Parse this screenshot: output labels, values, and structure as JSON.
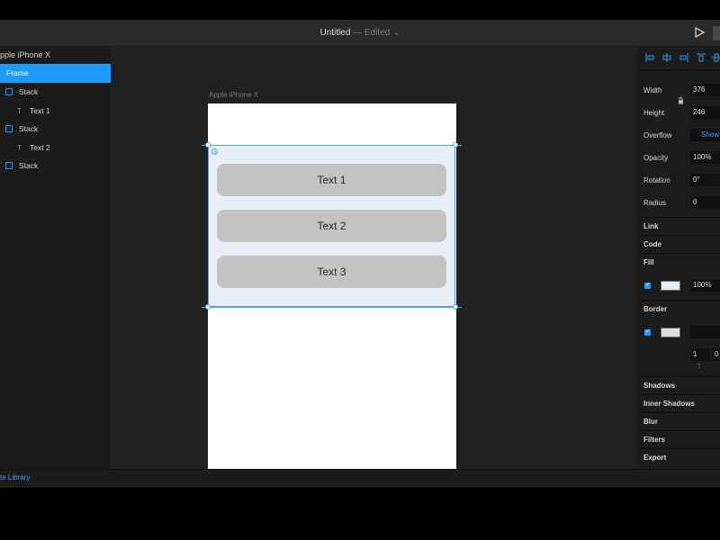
{
  "window": {
    "title": "Untitled",
    "edited_suffix": " — Edited ⌄"
  },
  "layers": {
    "title": "pple iPhone X",
    "items": [
      {
        "label": "Frame",
        "type": "frame",
        "selected": true
      },
      {
        "label": "Stack",
        "type": "stack"
      },
      {
        "label": "Text 1",
        "type": "text"
      },
      {
        "label": "Stack",
        "type": "stack"
      },
      {
        "label": "Text 2",
        "type": "text"
      },
      {
        "label": "Stack",
        "type": "stack"
      }
    ]
  },
  "canvas": {
    "frame_label": "Apple iPhone X",
    "stack_items": [
      "Text 1",
      "Text 2",
      "Text 3"
    ]
  },
  "properties": {
    "width_label": "Width",
    "width_value": "376",
    "height_label": "Height",
    "height_value": "246",
    "overflow_label": "Overflow",
    "overflow_value": "Show",
    "opacity_label": "Opacity",
    "opacity_value": "100%",
    "rotation_label": "Rotation",
    "rotation_value": "0°",
    "radius_label": "Radius",
    "radius_value": "0",
    "sections": {
      "link": "Link",
      "code": "Code",
      "fill": "Fill",
      "border": "Border",
      "shadows": "Shadows",
      "inner_shadows": "Inner Shadows",
      "blur": "Blur",
      "filters": "Filters",
      "export": "Export"
    },
    "fill_opacity": "100%",
    "border_width": "1",
    "border_extra": "0",
    "border_t": "T"
  },
  "bottom": {
    "library_label": "te Library"
  },
  "colors": {
    "accent": "#1e9bff",
    "stack_bg": "#e8eef5",
    "item_bg": "#c2c2c2"
  }
}
